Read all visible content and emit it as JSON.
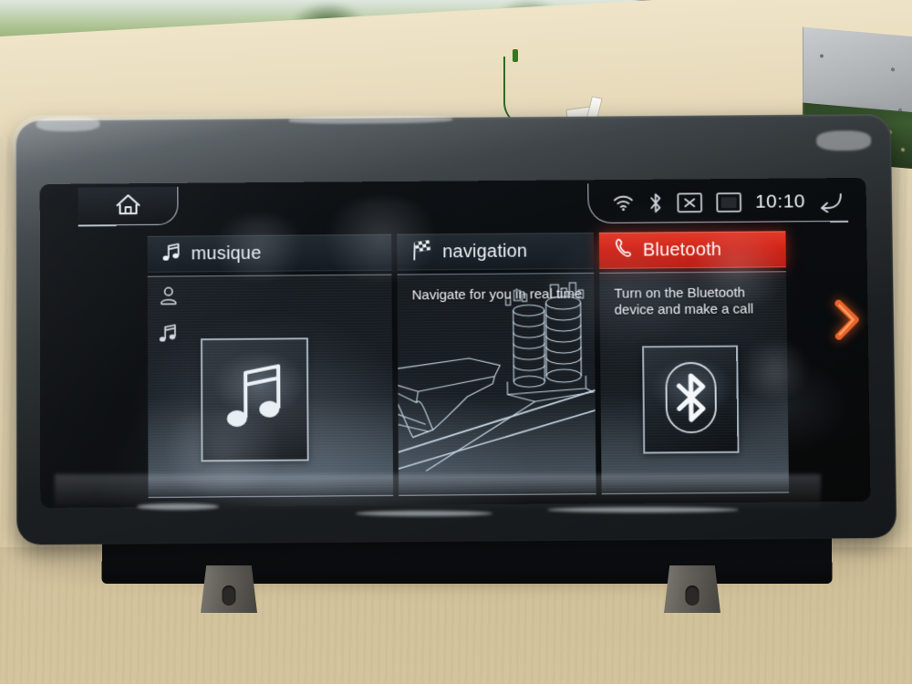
{
  "device": {
    "product_name": "car-head-unit-display",
    "screen_state": "home-menu"
  },
  "statusbar": {
    "icons": [
      "wifi-icon",
      "bluetooth-icon",
      "x-in-box-icon",
      "display-icon"
    ],
    "time": "10:10",
    "back_icon": "back-arrow-icon"
  },
  "home_button": {
    "icon": "home-icon",
    "label": ""
  },
  "tiles": [
    {
      "id": "musique",
      "icon": "music-note-icon",
      "title": "musique",
      "active": false,
      "side_icons": [
        "person-icon",
        "music-note-icon"
      ],
      "artwork_icon": "music-note-icon",
      "blurb": ""
    },
    {
      "id": "navigation",
      "icon": "checkered-flag-icon",
      "title": "navigation",
      "active": false,
      "side_icons": [],
      "artwork_icon": "wireframe-cityscape",
      "blurb": "Navigate for you in real time"
    },
    {
      "id": "bluetooth",
      "icon": "phone-handset-icon",
      "title": "Bluetooth",
      "active": true,
      "side_icons": [],
      "artwork_icon": "bluetooth-icon",
      "blurb": "Turn on the Bluetooth device and make a call"
    }
  ],
  "next_button": {
    "icon": "chevron-right-icon"
  },
  "colors": {
    "accent_red": "#d42418",
    "accent_orange": "#e8632a",
    "screen_text": "#eef3f7",
    "tile_bg": "#1a2128",
    "bezel": "#2e3336"
  }
}
